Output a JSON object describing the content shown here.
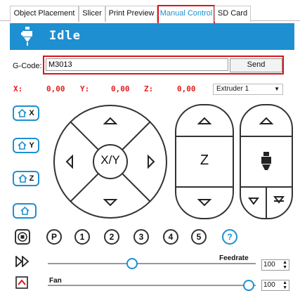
{
  "tabs": [
    {
      "label": "Object Placement"
    },
    {
      "label": "Slicer"
    },
    {
      "label": "Print Preview"
    },
    {
      "label": "Manual Control"
    },
    {
      "label": "SD Card"
    }
  ],
  "status": "Idle",
  "gcode": {
    "label": "G-Code:",
    "value": "M3013",
    "send_label": "Send"
  },
  "coords": {
    "x_label": "X:",
    "x_value": "0,00",
    "y_label": "Y:",
    "y_value": "0,00",
    "z_label": "Z:",
    "z_value": "0,00"
  },
  "extruder": {
    "selected": "Extruder 1"
  },
  "home_buttons": {
    "x": "X",
    "y": "Y",
    "z": "Z"
  },
  "xy_pad": {
    "center_label": "X/Y"
  },
  "z_pad": {
    "label": "Z"
  },
  "fan_presets": [
    "P",
    "1",
    "2",
    "3",
    "4",
    "5",
    "?"
  ],
  "feedrate": {
    "label": "Feedrate",
    "value": "100",
    "level": 0.4
  },
  "fan": {
    "label": "Fan",
    "value": "100",
    "level": 1.0
  },
  "colors": {
    "accent": "#1e8fd0",
    "highlight": "#d9161c",
    "coord": "#e02020"
  }
}
